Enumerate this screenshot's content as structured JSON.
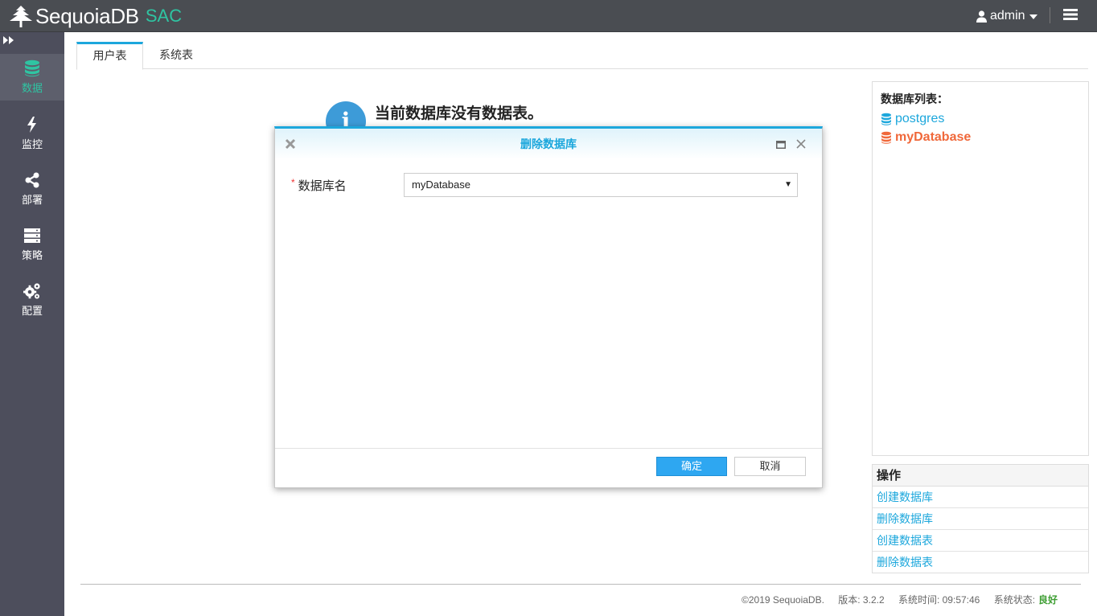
{
  "header": {
    "logo_text": "SequoiaDB",
    "logo_sub": "SAC",
    "user": "admin",
    "icons": [
      "tree-logo-icon",
      "user-icon",
      "chevron-down-icon",
      "settings-panel-icon"
    ]
  },
  "sidebar": {
    "items": [
      {
        "label": "数据",
        "icon": "database-icon",
        "active": true
      },
      {
        "label": "监控",
        "icon": "bolt-icon"
      },
      {
        "label": "部署",
        "icon": "share-icon"
      },
      {
        "label": "策略",
        "icon": "server-icon"
      },
      {
        "label": "配置",
        "icon": "gears-icon"
      }
    ]
  },
  "tabs": [
    {
      "label": "用户表",
      "active": true
    },
    {
      "label": "系统表"
    }
  ],
  "main": {
    "empty_message": "当前数据库没有数据表。",
    "info_glyph": "i"
  },
  "db_list": {
    "title": "数据库列表：",
    "items": [
      {
        "name": "postgres",
        "color": "#1ca7dc"
      },
      {
        "name": "myDatabase",
        "color": "#f0683a",
        "selected": true
      }
    ]
  },
  "ops": {
    "title": "操作",
    "items": [
      "创建数据库",
      "删除数据库",
      "创建数据表",
      "删除数据表"
    ]
  },
  "footer": {
    "copyright": "©2019 SequoiaDB.",
    "version": "版本: 3.2.2",
    "time": "系统时间: 09:57:46",
    "status_label": "系统状态:",
    "status_value": "良好"
  },
  "modal": {
    "title": "删除数据库",
    "required_mark": "*",
    "field_label": "数据库名",
    "field_value": "myDatabase",
    "ok_label": "确定",
    "cancel_label": "取消"
  },
  "colors": {
    "accent": "#1ca7dc",
    "brand_green": "#2fc4a2",
    "selected_db": "#f0683a",
    "status_ok": "#3e9e33"
  }
}
